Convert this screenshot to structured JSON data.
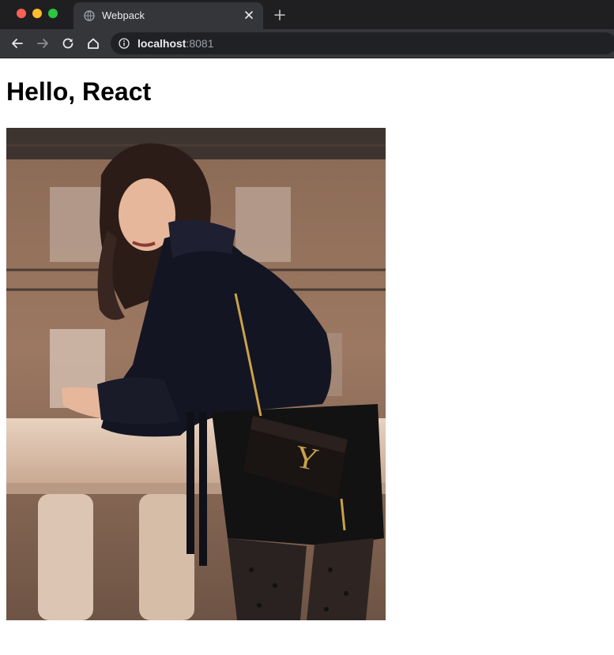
{
  "browser": {
    "tab": {
      "title": "Webpack"
    },
    "address_bar": {
      "host": "localhost",
      "port": ":8081"
    }
  },
  "page": {
    "heading": "Hello, React",
    "photo": {
      "description_icon": "photo-image",
      "colors": {
        "stone": "#c9a68e",
        "blouse": "#141522",
        "bag": "#1a1413",
        "gold": "#c9a24a"
      }
    }
  }
}
